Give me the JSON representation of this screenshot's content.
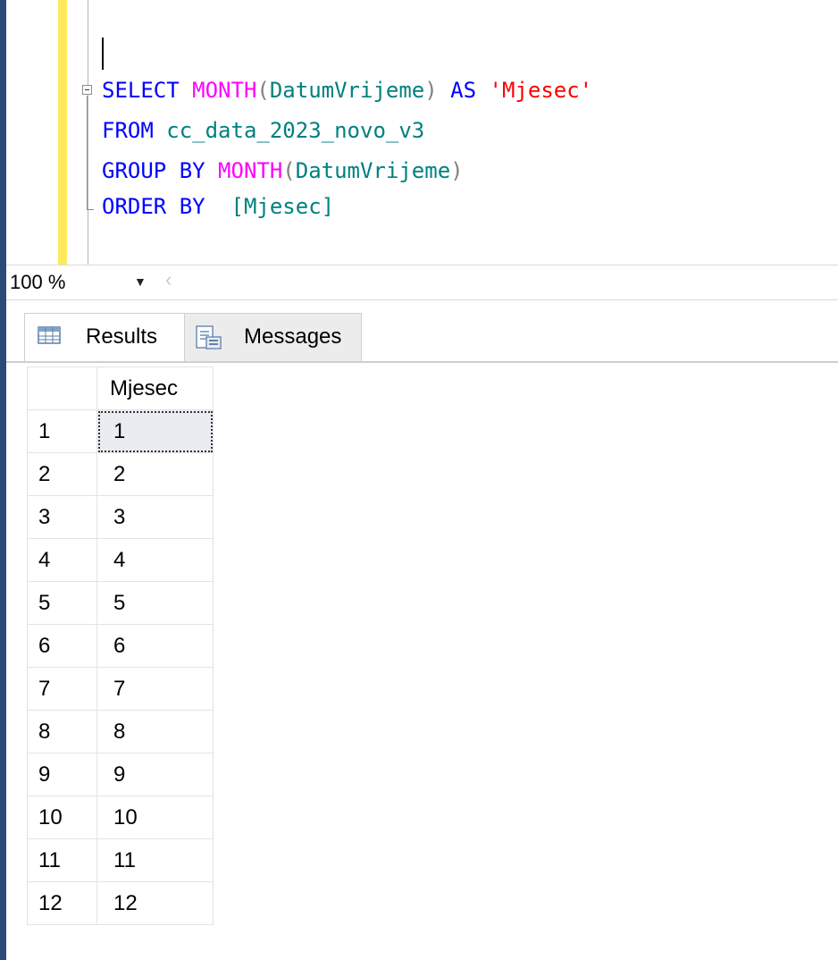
{
  "editor": {
    "lines": [
      {
        "tokens": [
          {
            "text": "SELECT ",
            "kind": "kw"
          },
          {
            "text": "MONTH",
            "kind": "fn"
          },
          {
            "text": "(",
            "kind": "gr"
          },
          {
            "text": "DatumVrijeme",
            "kind": "id"
          },
          {
            "text": ") ",
            "kind": "gr"
          },
          {
            "text": "AS ",
            "kind": "kw"
          },
          {
            "text": "'Mjesec'",
            "kind": "str"
          }
        ]
      },
      {
        "tokens": [
          {
            "text": "FROM ",
            "kind": "kw"
          },
          {
            "text": "cc_data_2023_novo_v3",
            "kind": "id"
          }
        ]
      },
      {
        "tokens": [
          {
            "text": "GROUP BY ",
            "kind": "kw"
          },
          {
            "text": "MONTH",
            "kind": "fn"
          },
          {
            "text": "(",
            "kind": "gr"
          },
          {
            "text": "DatumVrijeme",
            "kind": "id"
          },
          {
            "text": ")",
            "kind": "gr"
          }
        ]
      },
      {
        "tokens": [
          {
            "text": "ORDER BY  ",
            "kind": "kw"
          },
          {
            "text": "[Mjesec]",
            "kind": "id"
          }
        ]
      }
    ]
  },
  "zoom": {
    "value": "100 %",
    "arrow_icon": "dropdown-arrow-icon",
    "scroll_icon": "scroll-left-icon"
  },
  "tabs": [
    {
      "label": "Results",
      "icon": "grid-icon",
      "active": true
    },
    {
      "label": "Messages",
      "icon": "messages-icon",
      "active": false
    }
  ],
  "results": {
    "columns": [
      "Mjesec"
    ],
    "rows": [
      {
        "num": "1",
        "value": "1"
      },
      {
        "num": "2",
        "value": "2"
      },
      {
        "num": "3",
        "value": "3"
      },
      {
        "num": "4",
        "value": "4"
      },
      {
        "num": "5",
        "value": "5"
      },
      {
        "num": "6",
        "value": "6"
      },
      {
        "num": "7",
        "value": "7"
      },
      {
        "num": "8",
        "value": "8"
      },
      {
        "num": "9",
        "value": "9"
      },
      {
        "num": "10",
        "value": "10"
      },
      {
        "num": "11",
        "value": "11"
      },
      {
        "num": "12",
        "value": "12"
      }
    ]
  },
  "colors": {
    "keyword": "#0000ff",
    "function": "#ff00ff",
    "identifier": "#008080",
    "string": "#ff0000",
    "punctuation": "#808080",
    "gutter_marker": "#fde95b",
    "selected_cell": "#e9edf1"
  }
}
